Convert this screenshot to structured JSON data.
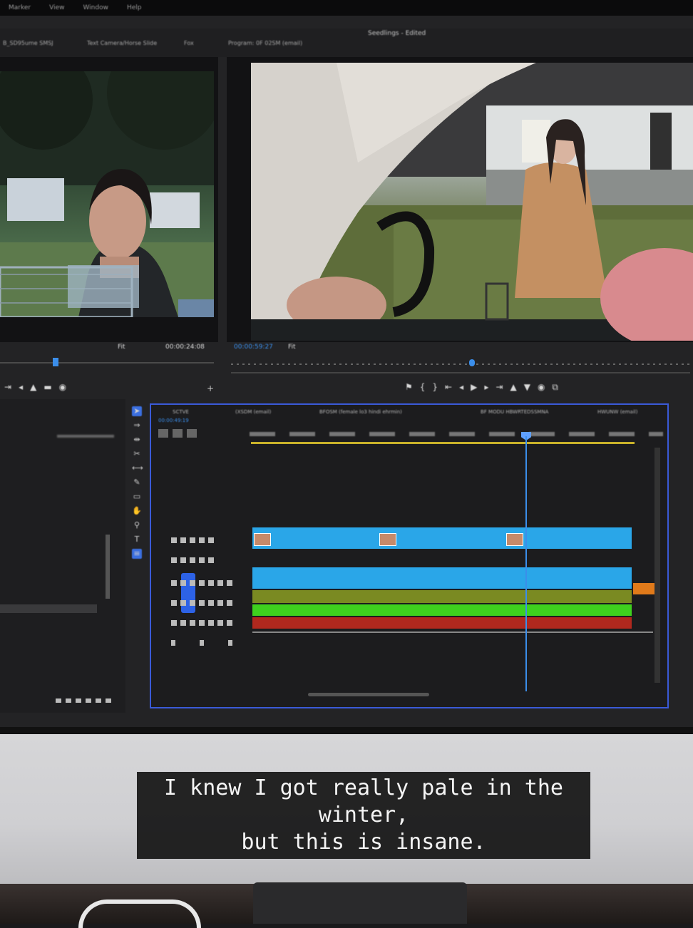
{
  "menubar": {
    "items": [
      "Marker",
      "View",
      "Window",
      "Help"
    ]
  },
  "project_title": "Seedlings - Edited",
  "tabs": [
    "B_SD95ume SMSJ",
    "Text Camera/Horse Slide",
    "Fox",
    "Program: 0F 02SM (email)"
  ],
  "source_monitor": {
    "timecode": "00:00:24:08",
    "fit": "Fit"
  },
  "program_monitor": {
    "timecode": "00:00:59:27",
    "fit": "Fit"
  },
  "timeline": {
    "timecode": "00:00:49:19",
    "sequence_tabs": [
      "SCTVE",
      "(XSDM (email)",
      "BFOSM (female lo3 hindi ehrmin)",
      "BF MODU HBWRTEDSSMNA",
      "HWUNW (email)"
    ]
  },
  "colors": {
    "accent": "#3b8eea",
    "video_clip": "#2aa6e8",
    "audio_green": "#3ed11e",
    "audio_olive": "#7a8a22",
    "audio_red": "#b0281e"
  },
  "subtitle": {
    "line1": "I knew I got really pale in the",
    "line2": "winter,",
    "line3": "but this is insane."
  }
}
